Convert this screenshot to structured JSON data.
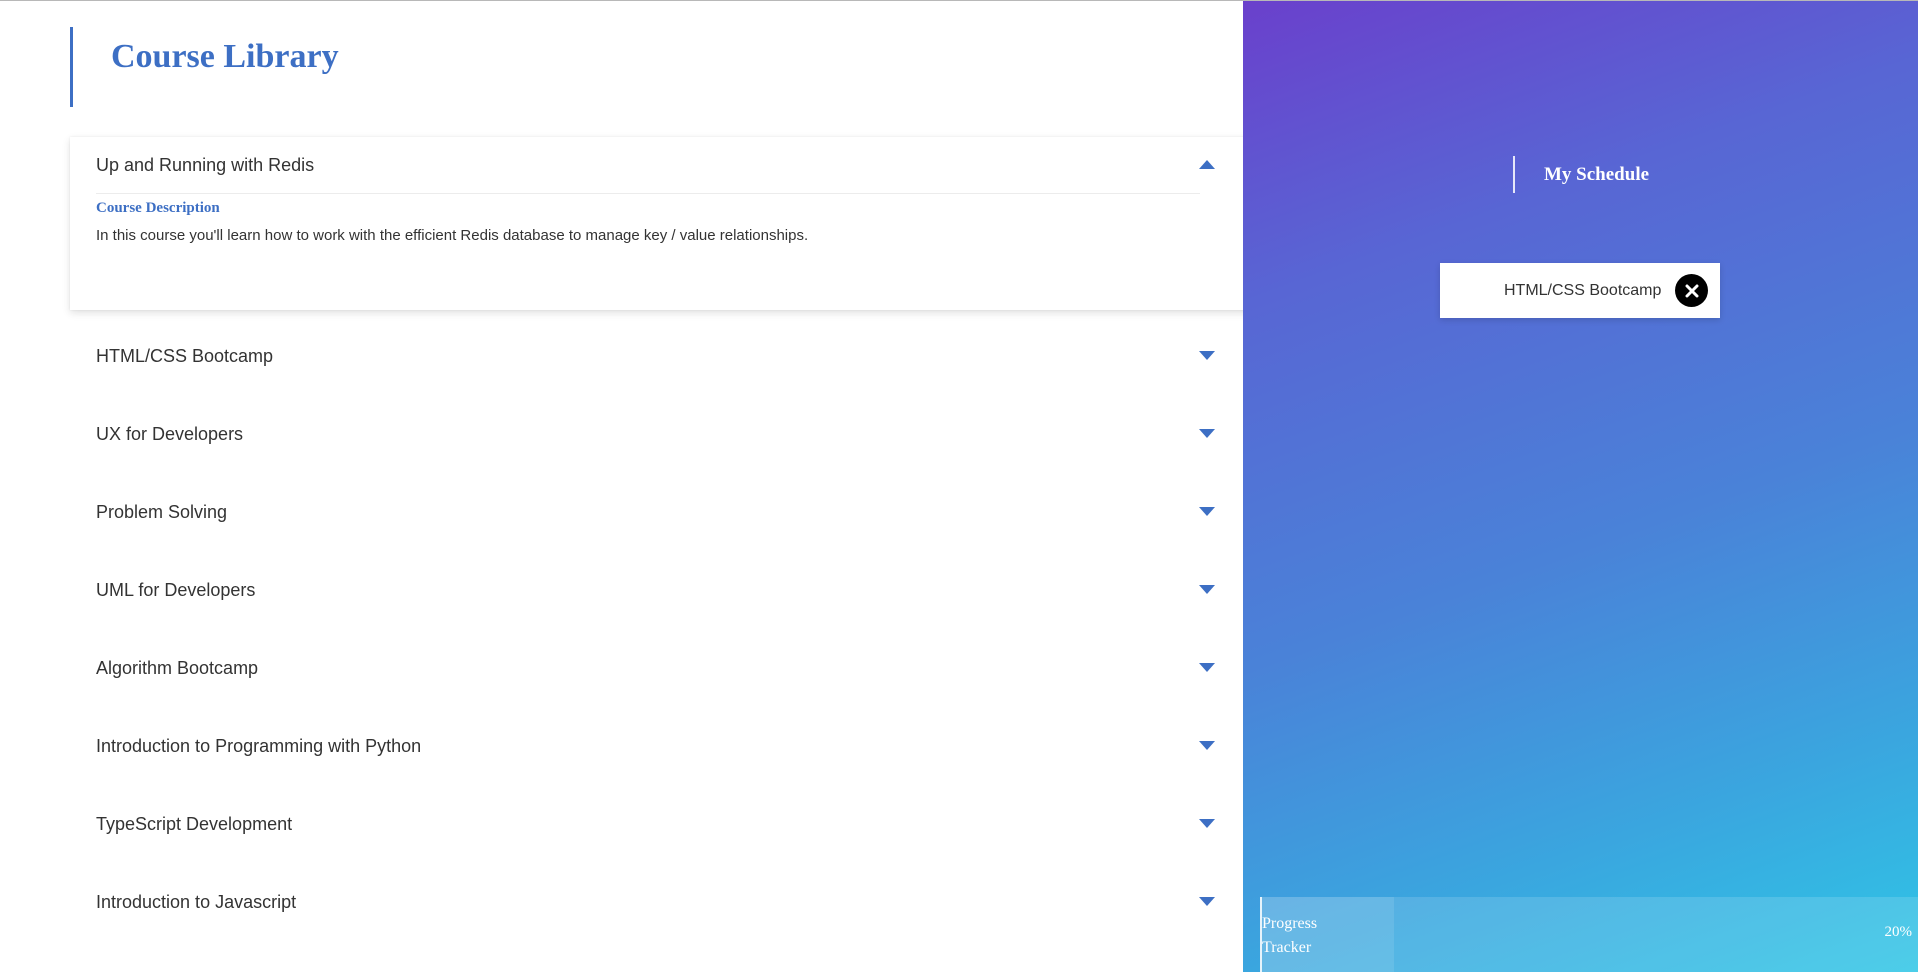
{
  "library": {
    "title": "Course Library",
    "courses": [
      {
        "name": "Up and Running with Redis",
        "expanded": true,
        "description_label": "Course Description",
        "description": "In this course you'll learn how to work with the efficient Redis database to manage key / value relationships."
      },
      {
        "name": "HTML/CSS Bootcamp",
        "expanded": false
      },
      {
        "name": "UX for Developers",
        "expanded": false
      },
      {
        "name": "Problem Solving",
        "expanded": false
      },
      {
        "name": "UML for Developers",
        "expanded": false
      },
      {
        "name": "Algorithm Bootcamp",
        "expanded": false
      },
      {
        "name": "Introduction to Programming with Python",
        "expanded": false
      },
      {
        "name": "TypeScript Development",
        "expanded": false
      },
      {
        "name": "Introduction to Javascript",
        "expanded": false
      }
    ]
  },
  "schedule": {
    "title": "My Schedule",
    "items": [
      {
        "name": "HTML/CSS Bootcamp",
        "remove_icon": "close-icon"
      }
    ]
  },
  "progress": {
    "label": "Progress Tracker",
    "value_text": "20%",
    "fraction": 0.2
  },
  "colors": {
    "accent": "#3d6fc4",
    "gradient_start": "#6a40cc",
    "gradient_end": "#2fc6e6"
  }
}
